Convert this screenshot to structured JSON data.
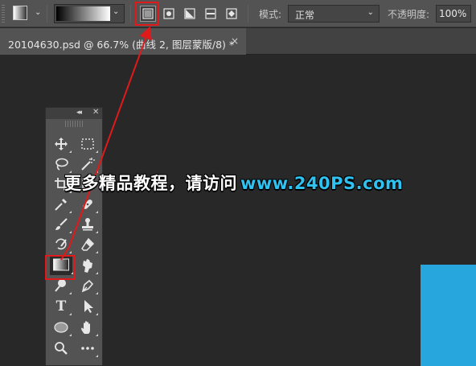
{
  "options_bar": {
    "tool_preset_icon": "gradient-tool-icon",
    "gradient_type_buttons": [
      {
        "name": "linear-gradient-icon",
        "selected": true
      },
      {
        "name": "radial-gradient-icon",
        "selected": false
      },
      {
        "name": "angle-gradient-icon",
        "selected": false
      },
      {
        "name": "reflected-gradient-icon",
        "selected": false
      },
      {
        "name": "diamond-gradient-icon",
        "selected": false
      }
    ],
    "mode_label": "模式:",
    "mode_value": "正常",
    "opacity_label": "不透明度:",
    "opacity_value": "100%"
  },
  "document_tab": {
    "title": "20104630.psd @ 66.7% (曲线 2, 图层蒙版/8) *",
    "close_glyph": "×"
  },
  "tools_panel": {
    "collapse_glyph": "◂◂",
    "close_glyph": "✕",
    "type_tool_glyph": "T",
    "tools": [
      "move-tool-icon",
      "marquee-tool-icon",
      "lasso-tool-icon",
      "magic-wand-tool-icon",
      "crop-tool-icon",
      "frame-tool-icon",
      "eyedropper-tool-icon",
      "healing-brush-tool-icon",
      "brush-tool-icon",
      "clone-stamp-tool-icon",
      "history-brush-tool-icon",
      "eraser-tool-icon",
      "gradient-tool-icon",
      "smudge-tool-icon",
      "dodge-tool-icon",
      "pen-tool-icon",
      "type-tool-icon",
      "path-selection-tool-icon",
      "ellipse-tool-icon",
      "hand-tool-icon",
      "zoom-tool-icon",
      "more-tools-icon"
    ],
    "active_tool": "gradient-tool-icon"
  },
  "watermark": {
    "text_cn": "更多精品教程，请访问",
    "text_url": "www.240PS.com"
  },
  "colors": {
    "annotation_red": "#e01a1a",
    "document_blue": "#27a6de",
    "watermark_url": "#2fc1f0"
  }
}
